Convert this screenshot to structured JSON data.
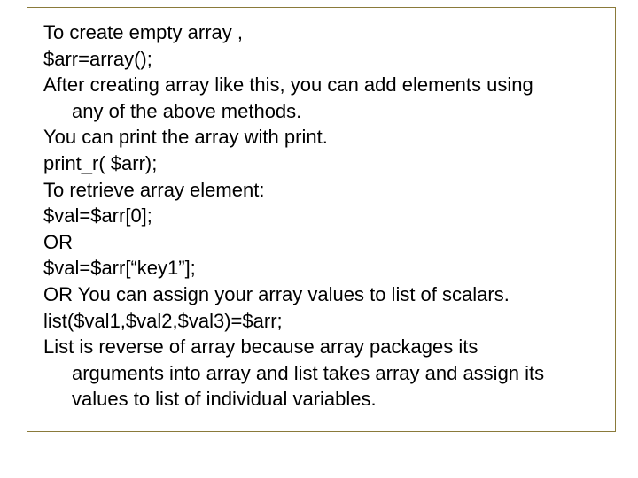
{
  "lines": {
    "l1": "To create empty array ,",
    "l2": "$arr=array();",
    "l3a": "After creating array like this, you can add elements using",
    "l3b": "any of the above methods.",
    "l4": "You can print the array with print.",
    "l5": "print_r( $arr);",
    "l6": "To retrieve array element:",
    "l7": "$val=$arr[0];",
    "l8": "OR",
    "l9": "$val=$arr[“key1”];",
    "l10": "OR You can assign your array values to list of scalars.",
    "l11": "list($val1,$val2,$val3)=$arr;",
    "l12a": "List is reverse of array because array packages its",
    "l12b": "arguments into array and list takes array and assign its",
    "l12c": "values to list of individual variables."
  }
}
